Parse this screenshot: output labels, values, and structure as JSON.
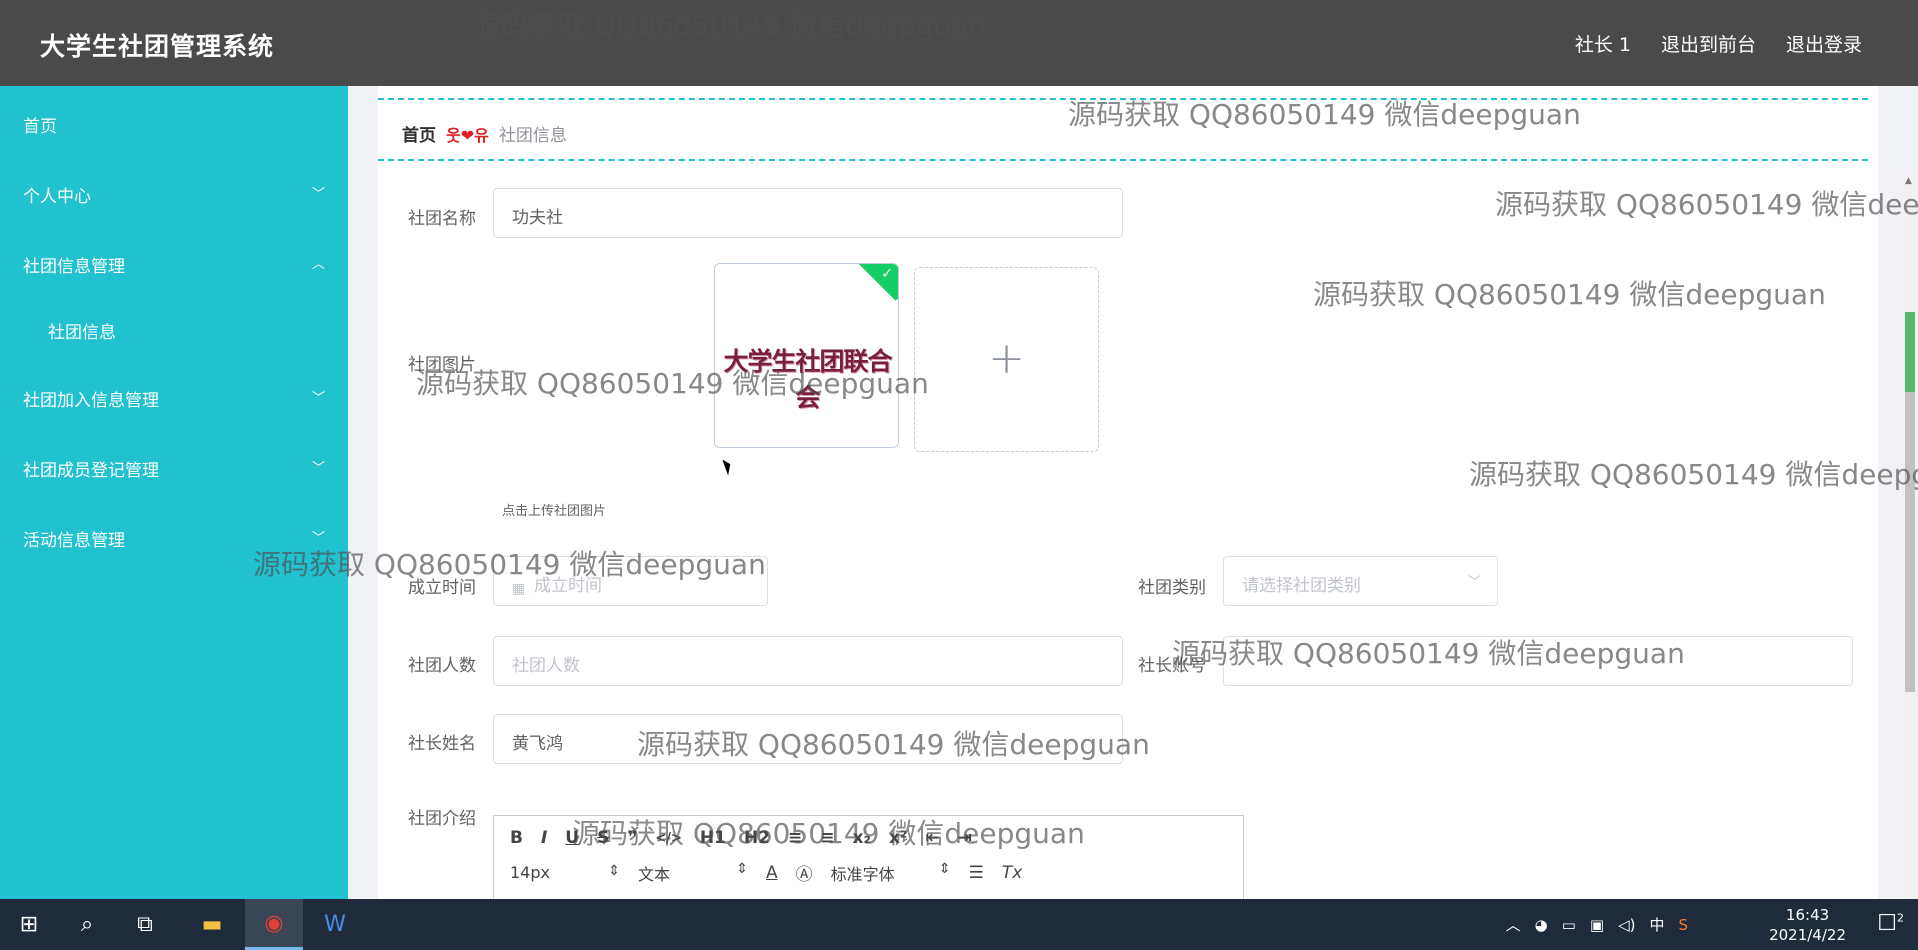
{
  "header": {
    "title": "大学生社团管理系统",
    "nav": [
      "社长 1",
      "退出到前台",
      "退出登录"
    ]
  },
  "sidebar": {
    "items": [
      {
        "label": "首页"
      },
      {
        "label": "个人中心",
        "chevron": "﹀"
      },
      {
        "label": "社团信息管理",
        "chevron": "︿"
      },
      {
        "label": "社团信息"
      },
      {
        "label": "社团加入信息管理",
        "chevron": "﹀"
      },
      {
        "label": "社团成员登记管理",
        "chevron": "﹀"
      },
      {
        "label": "活动信息管理",
        "chevron": "﹀"
      }
    ]
  },
  "breadcrumb": {
    "home": "首页",
    "separator": "웃❤유",
    "current": "社团信息"
  },
  "form": {
    "club_name": {
      "label": "社团名称",
      "value": "功夫社"
    },
    "club_image": {
      "label": "社团图片",
      "image_text": "大学生社团联合会",
      "add_icon": "+",
      "hint": "点击上传社团图片"
    },
    "founded": {
      "label": "成立时间",
      "placeholder": "成立时间"
    },
    "category": {
      "label": "社团类别",
      "placeholder": "请选择社团类别"
    },
    "members": {
      "label": "社团人数",
      "placeholder": "社团人数"
    },
    "president_account": {
      "label": "社长账号",
      "value": ""
    },
    "president_name": {
      "label": "社长姓名",
      "value": "黄飞鸿"
    },
    "intro": {
      "label": "社团介绍"
    }
  },
  "editor": {
    "row1": [
      "B",
      "I",
      "U",
      "S",
      "❞",
      "</>",
      "H1",
      "H2",
      "≡",
      "≡",
      "x₂",
      "x²",
      "⇤",
      "⇥"
    ],
    "font_size": "14px",
    "block_type": "文本",
    "font_family": "标准字体"
  },
  "watermark": "源码获取 QQ86050149 微信deepguan",
  "taskbar": {
    "time": "16:43",
    "date": "2021/4/22",
    "ime": "中",
    "notification_count": "2"
  },
  "colors": {
    "sidebar": "#22c1cf",
    "topbar": "#4a4a4a",
    "accent_dashed": "#22c1cf"
  }
}
